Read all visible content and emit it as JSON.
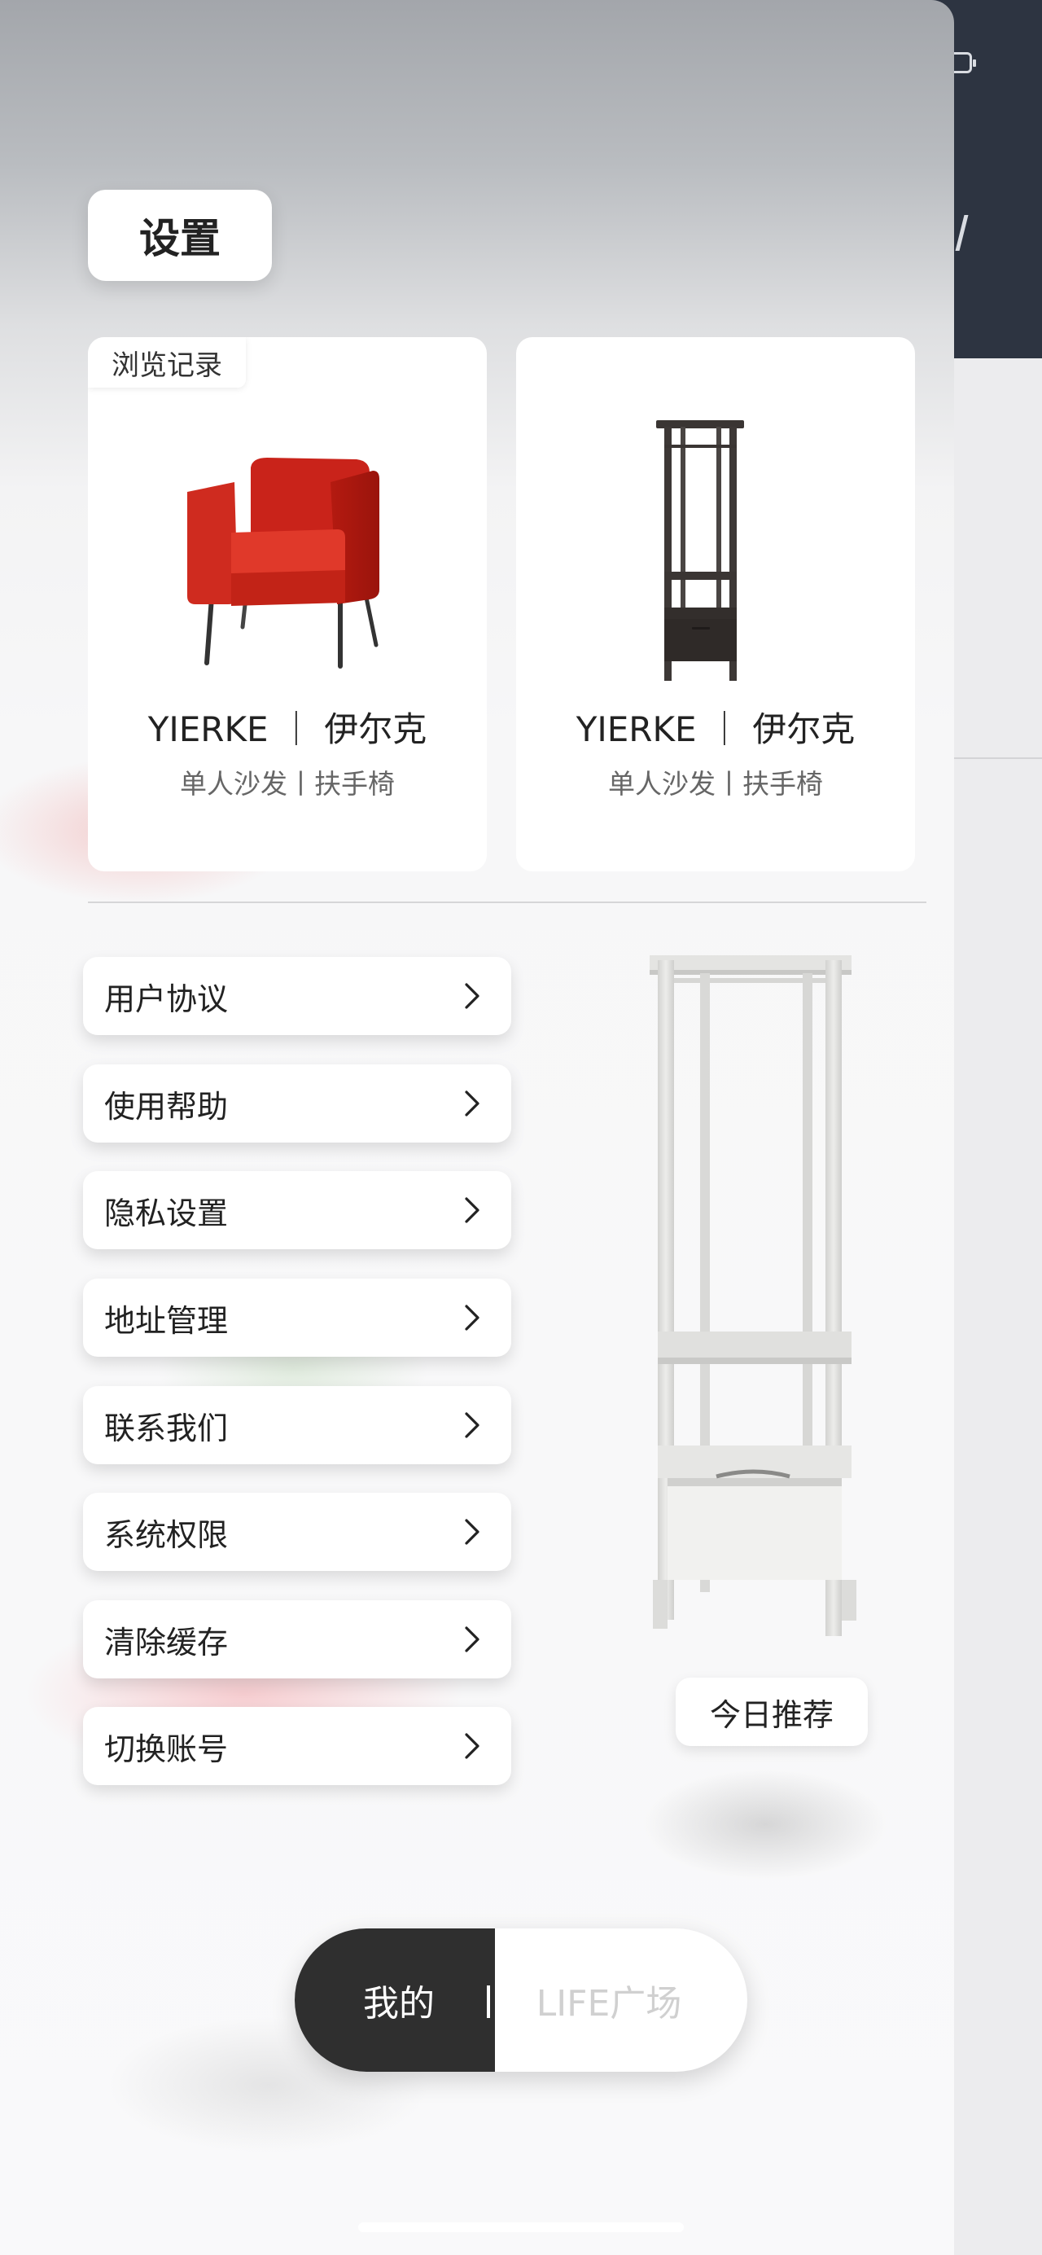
{
  "header": {
    "title": "设置"
  },
  "history": {
    "tag": "浏览记录",
    "items": [
      {
        "name": "YIERKE ｜ 伊尔克",
        "subtitle": "单人沙发丨扶手椅",
        "image": "red-armchair"
      },
      {
        "name": "YIERKE ｜ 伊尔克",
        "subtitle": "单人沙发丨扶手椅",
        "image": "dark-shelf-unit"
      }
    ]
  },
  "menu": {
    "items": [
      {
        "label": "用户协议",
        "icon": "chevron-right-icon"
      },
      {
        "label": "使用帮助",
        "icon": "chevron-right-icon"
      },
      {
        "label": "隐私设置",
        "icon": "chevron-right-icon"
      },
      {
        "label": "地址管理",
        "icon": "chevron-right-icon"
      },
      {
        "label": "联系我们",
        "icon": "chevron-right-icon"
      },
      {
        "label": "系统权限",
        "icon": "chevron-right-icon"
      },
      {
        "label": "清除缓存",
        "icon": "chevron-right-icon"
      },
      {
        "label": "切换账号",
        "icon": "chevron-right-icon"
      }
    ]
  },
  "recommendation": {
    "label": "今日推荐",
    "image": "white-open-wardrobe"
  },
  "bottom_toggle": {
    "active": "我的",
    "separator": "|",
    "inactive": "LIFE广场"
  },
  "colors": {
    "toggle_active_bg": "#2f2f2f",
    "panel_bg": "#f7f7f8",
    "card_bg": "#ffffff",
    "background_app_header": "#2d3441"
  }
}
